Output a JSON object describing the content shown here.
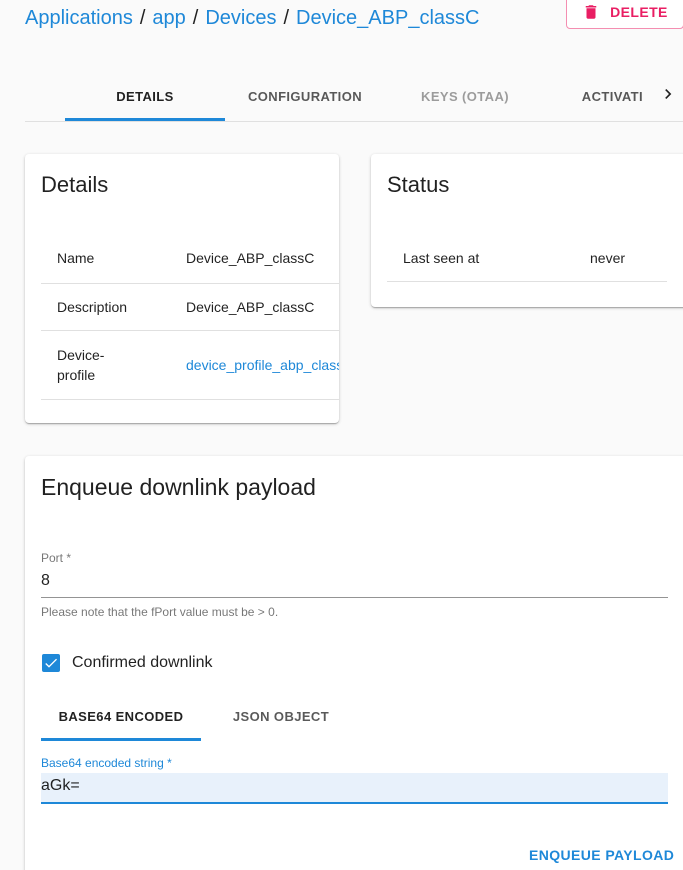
{
  "breadcrumb": {
    "items": [
      "Applications",
      "app",
      "Devices",
      "Device_ABP_classC"
    ],
    "separator": "/"
  },
  "header": {
    "delete_label": "DELETE",
    "delete_icon": "trash-icon"
  },
  "tabs": [
    {
      "label": "DETAILS",
      "state": "active"
    },
    {
      "label": "CONFIGURATION",
      "state": "normal"
    },
    {
      "label": "KEYS (OTAA)",
      "state": "disabled"
    },
    {
      "label": "ACTIVATI",
      "state": "normal"
    }
  ],
  "tab_scroll_icon": "chevron-right-icon",
  "details_card": {
    "title": "Details",
    "rows": [
      {
        "label": "Name",
        "value": "Device_ABP_classC"
      },
      {
        "label": "Description",
        "value": "Device_ABP_classC"
      },
      {
        "label": "Device-profile",
        "label_line1": "Device-",
        "label_line2": "profile",
        "value": "device_profile_abp_class"
      }
    ]
  },
  "status_card": {
    "title": "Status",
    "rows": [
      {
        "label": "Last seen at",
        "value": "never"
      }
    ]
  },
  "enqueue_card": {
    "title": "Enqueue downlink payload",
    "port": {
      "label": "Port *",
      "value": "8",
      "helper": "Please note that the fPort value must be > 0."
    },
    "confirmed": {
      "label": "Confirmed downlink",
      "checked": true,
      "icon": "check-icon"
    },
    "payload_tabs": [
      {
        "label": "BASE64 ENCODED",
        "state": "active"
      },
      {
        "label": "JSON OBJECT",
        "state": "normal"
      }
    ],
    "base64": {
      "label": "Base64 encoded string *",
      "value": "aGk="
    },
    "submit_label": "ENQUEUE PAYLOAD"
  },
  "colors": {
    "primary": "#1e88d8",
    "danger": "#e91e63",
    "input_fill": "#e8f1fb"
  }
}
